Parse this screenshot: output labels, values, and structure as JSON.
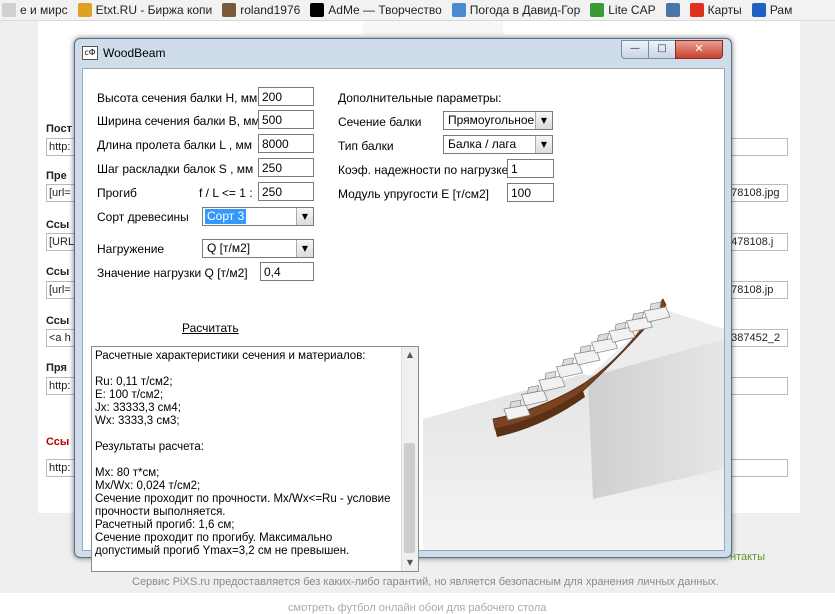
{
  "bookmarks": [
    {
      "label": "е и мирс",
      "icon": "page-icon",
      "color": "#d0d0d0"
    },
    {
      "label": "Etxt.RU - Биржа копи",
      "icon": "pen-icon",
      "color": "#e0a020"
    },
    {
      "label": "roland1976",
      "icon": "user-icon",
      "color": "#7a5a3a"
    },
    {
      "label": "AdMe — Творчество",
      "icon": "adme-logo-icon",
      "color": "#000000"
    },
    {
      "label": "Погода в Давид-Гор",
      "icon": "weather-icon",
      "color": "#4a8ad0"
    },
    {
      "label": "Lite CAP",
      "icon": "globe-icon",
      "color": "#3a9a3a"
    },
    {
      "label": "",
      "icon": "vk-icon",
      "color": "#4a76a8"
    },
    {
      "label": "Карты",
      "icon": "map-pin-icon",
      "color": "#e03020"
    },
    {
      "label": "Рам",
      "icon": "bookmark-icon",
      "color": "#2060c0"
    }
  ],
  "background_page": {
    "labels": [
      "Пост",
      "Пре",
      "Ссы",
      "Ссы",
      "Ссы",
      "Пря",
      "Ссы"
    ],
    "left_inputs": [
      "http:",
      "[url=",
      "[URL",
      "[url=",
      "<a h",
      "http:",
      "http:"
    ],
    "right_inputs": [
      "",
      "478108.jpg",
      "8478108.j",
      "478108.jp",
      "2387452_2",
      "",
      ""
    ],
    "contacts": "нтакты",
    "footer": "Сервис PiXS.ru предоставляется без каких-либо гарантий, но является безопасным для хранения личных данных.",
    "footer2": "смотреть футбол онлайн обои для рабочего стола"
  },
  "window": {
    "title": "WoodBeam",
    "app_icon": "cФ",
    "controls": {
      "minimize": "—",
      "maximize": "□",
      "close": "✕"
    }
  },
  "form": {
    "height": {
      "label": "Высота сечения балки H, мм",
      "value": "200"
    },
    "width": {
      "label": "Ширина сечения балки B, мм",
      "value": "500"
    },
    "span": {
      "label": "Длина пролета балки L  , мм",
      "value": "8000"
    },
    "spacing": {
      "label": "Шаг раскладки балок S  , мм",
      "value": "250"
    },
    "deflection": {
      "label_left": "Прогиб",
      "label_right": "f / L <= 1 :",
      "value": "250"
    },
    "wood_grade": {
      "label": "Сорт древесины",
      "value": "Сорт 3"
    },
    "loading": {
      "label": "Нагружение",
      "value": "Q [т/м2]"
    },
    "load_value": {
      "label": "Значение нагрузки Q [т/м2]",
      "value": "0,4"
    },
    "calculate": "Расчитать"
  },
  "extra": {
    "title": "Дополнительные параметры:",
    "section": {
      "label": "Сечение балки",
      "value": "Прямоугольное"
    },
    "beam_type": {
      "label": "Тип балки",
      "value": "Балка / лага"
    },
    "reliability": {
      "label": "Коэф. надежности по нагрузке",
      "value": "1"
    },
    "modulus": {
      "label": "Модуль упругости  E  [т/см2]",
      "value": "100"
    }
  },
  "results": [
    "Расчетные характеристики сечения и материалов:",
    "",
    "Ru: 0,11 т/см2;",
    "E: 100 т/см2;",
    "Jx: 33333,3 см4;",
    "Wx: 3333,3 см3;",
    "",
    "Результаты расчета:",
    "",
    "Mx: 80 т*см;",
    "Mx/Wx: 0,024 т/см2;",
    "Сечение проходит по прочности. Mx/Wx<=Ru - условие прочности выполняется.",
    "Расчетный прогиб: 1,6 см;",
    "Сечение проходит по прогибу. Максимально допустимый прогиб Ymax=3,2 см не превышен."
  ],
  "colors": {
    "close_button": "#c7402e",
    "beam": "#7a4420",
    "selection": "#3399ff"
  }
}
